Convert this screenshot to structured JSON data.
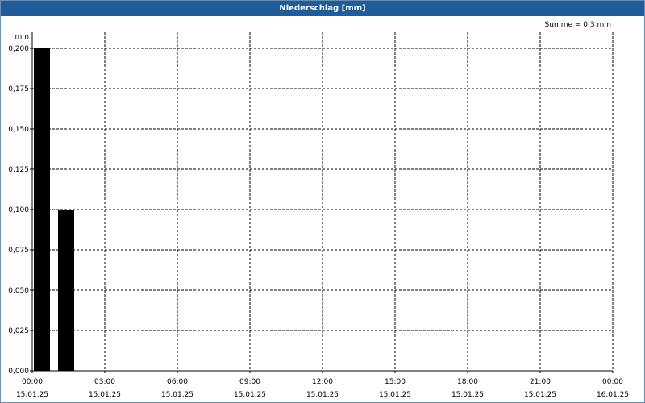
{
  "window": {
    "title": "Niederschlag [mm]"
  },
  "summary": "Summe = 0,3 mm",
  "colors": {
    "titlebar": "#1f5c99",
    "bars": "#000000",
    "grid": "#000000"
  },
  "chart_data": {
    "type": "bar",
    "title": "Niederschlag [mm]",
    "ylabel": "mm",
    "xlabel": "",
    "ylim": [
      0,
      0.2
    ],
    "yticks": [
      "0,000",
      "0,025",
      "0,050",
      "0,075",
      "0,100",
      "0,125",
      "0,150",
      "0,175",
      "0,200"
    ],
    "xlim_hours": [
      0,
      24
    ],
    "xticks": [
      {
        "time": "00:00",
        "date": "15.01.25"
      },
      {
        "time": "03:00",
        "date": "15.01.25"
      },
      {
        "time": "06:00",
        "date": "15.01.25"
      },
      {
        "time": "09:00",
        "date": "15.01.25"
      },
      {
        "time": "12:00",
        "date": "15.01.25"
      },
      {
        "time": "15:00",
        "date": "15.01.25"
      },
      {
        "time": "18:00",
        "date": "15.01.25"
      },
      {
        "time": "21:00",
        "date": "15.01.25"
      },
      {
        "time": "00:00",
        "date": "16.01.25"
      }
    ],
    "bars": [
      {
        "time": "00:00",
        "value": 0.2
      },
      {
        "time": "01:00",
        "value": 0.1
      }
    ],
    "grid": true
  }
}
